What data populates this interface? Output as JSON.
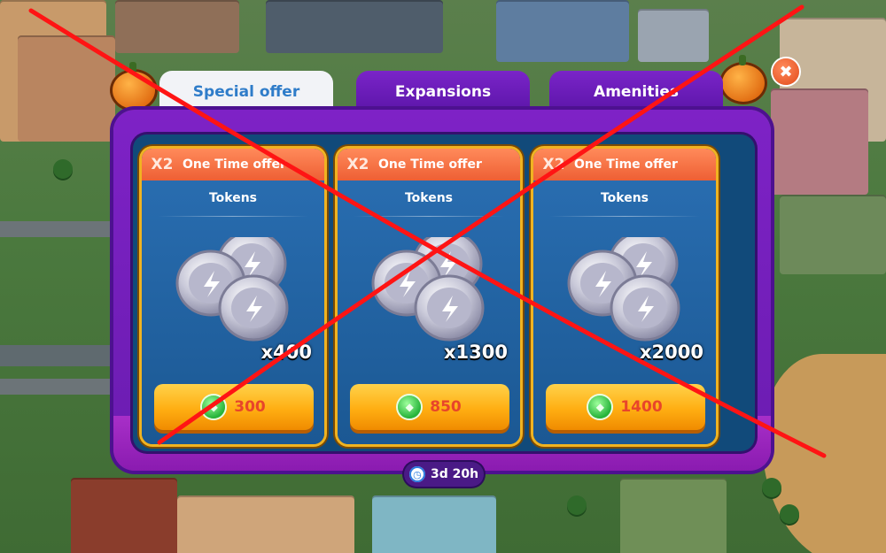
{
  "tabs": {
    "special_offer": "Special offer",
    "expansions": "Expansions",
    "amenities": "Amenities"
  },
  "offers": [
    {
      "multiplier": "X2",
      "label": "One Time offer",
      "item": "Tokens",
      "quantity": "x400",
      "price": "300"
    },
    {
      "multiplier": "X2",
      "label": "One Time offer",
      "item": "Tokens",
      "quantity": "x1300",
      "price": "850"
    },
    {
      "multiplier": "X2",
      "label": "One Time offer",
      "item": "Tokens",
      "quantity": "x2000",
      "price": "1400"
    }
  ],
  "timer": "3d 20h",
  "icons": {
    "close": "close-icon",
    "clock": "clock-icon",
    "currency": "gem-currency-icon",
    "coins": "token-coins-icon",
    "pumpkin": "pumpkin-decoration-icon"
  },
  "colors": {
    "panel": "#7e22c6",
    "card": "#2a6fb3",
    "card_header": "#ee5f34",
    "buy_button": "#ffae12",
    "cross_overlay": "#ff1414"
  }
}
